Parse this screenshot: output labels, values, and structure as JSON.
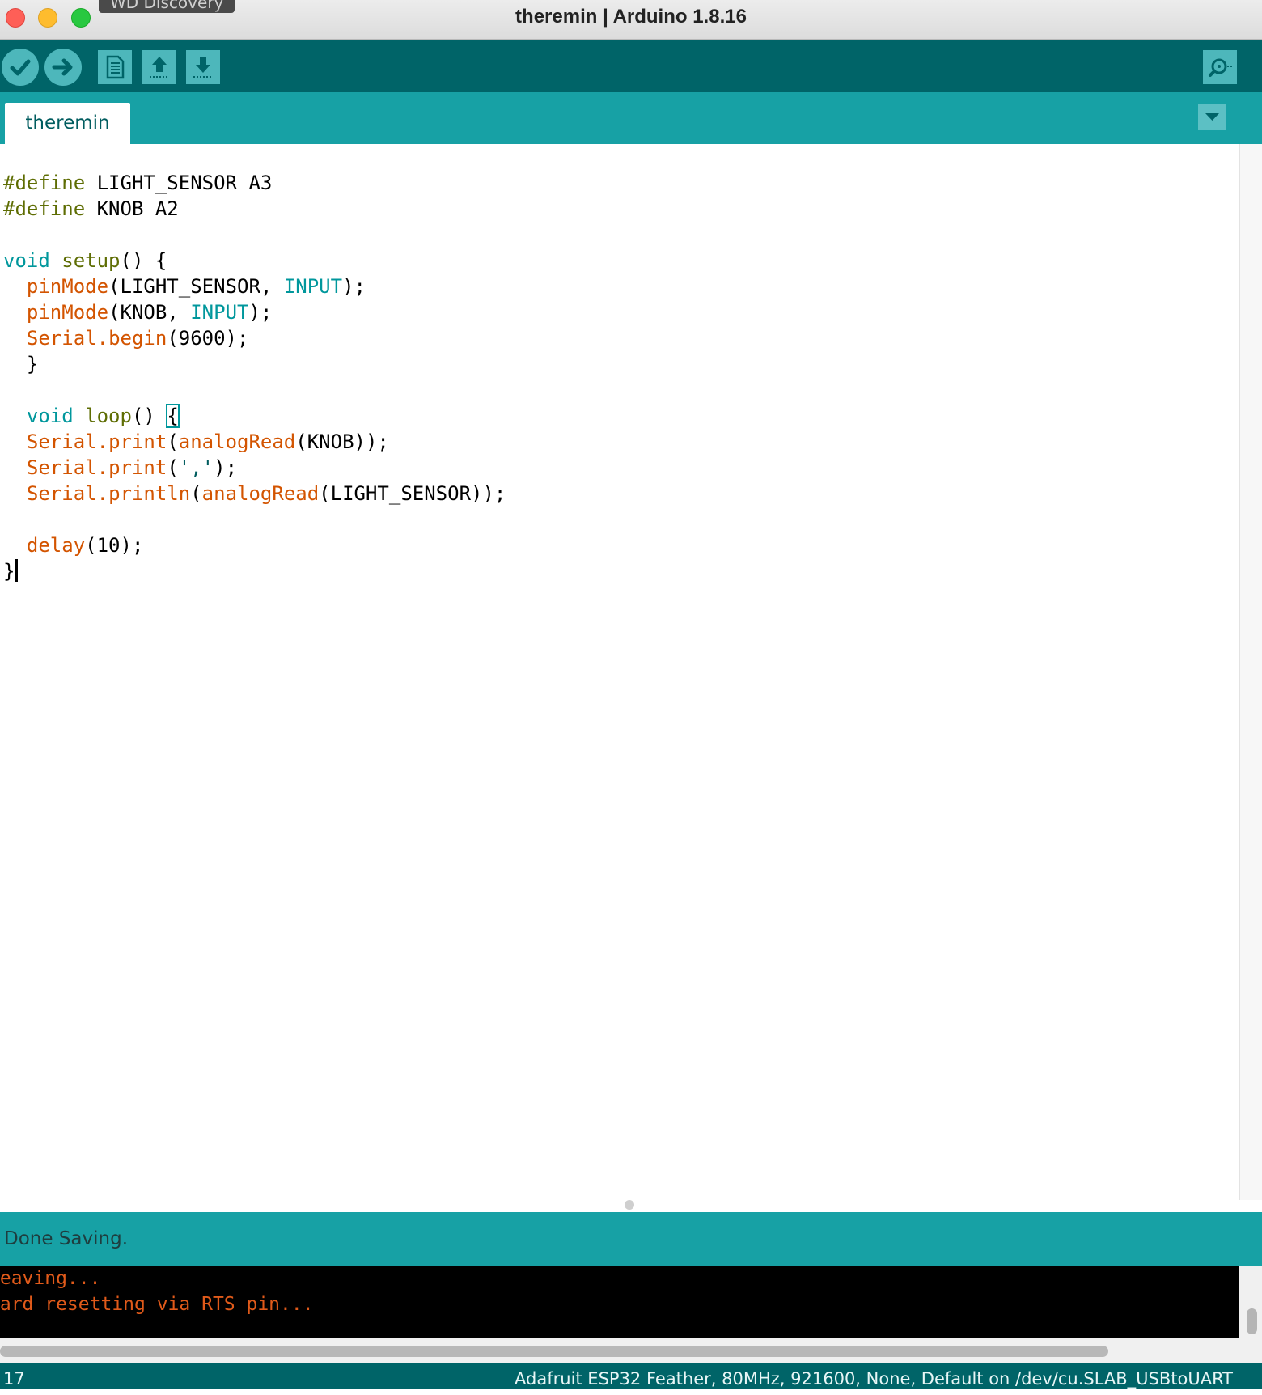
{
  "window": {
    "title": "theremin | Arduino 1.8.16",
    "tooltip": "WD Discovery"
  },
  "toolbar": {
    "verify": "check-icon",
    "upload": "arrow-right-icon",
    "new": "new-file-icon",
    "open": "upload-arrow-icon",
    "save": "download-arrow-icon",
    "serial_monitor": "magnifier-icon"
  },
  "tabs": [
    {
      "label": "theremin",
      "active": true
    }
  ],
  "editor": {
    "lines": [
      [
        {
          "t": "#define",
          "c": "pre"
        },
        {
          "t": " LIGHT_SENSOR A3"
        }
      ],
      [
        {
          "t": "#define",
          "c": "pre"
        },
        {
          "t": " KNOB A2"
        }
      ],
      [],
      [
        {
          "t": "void",
          "c": "type"
        },
        {
          "t": " "
        },
        {
          "t": "setup",
          "c": "pre"
        },
        {
          "t": "() {"
        }
      ],
      [
        {
          "t": "  "
        },
        {
          "t": "pinMode",
          "c": "fn"
        },
        {
          "t": "(LIGHT_SENSOR, "
        },
        {
          "t": "INPUT",
          "c": "const"
        },
        {
          "t": ");"
        }
      ],
      [
        {
          "t": "  "
        },
        {
          "t": "pinMode",
          "c": "fn"
        },
        {
          "t": "(KNOB, "
        },
        {
          "t": "INPUT",
          "c": "const"
        },
        {
          "t": ");"
        }
      ],
      [
        {
          "t": "  "
        },
        {
          "t": "Serial",
          "c": "fn"
        },
        {
          "t": ".",
          "c": "fn"
        },
        {
          "t": "begin",
          "c": "fn"
        },
        {
          "t": "(9600);"
        }
      ],
      [
        {
          "t": "  }"
        }
      ],
      [],
      [
        {
          "t": "  "
        },
        {
          "t": "void",
          "c": "type"
        },
        {
          "t": " "
        },
        {
          "t": "loop",
          "c": "pre"
        },
        {
          "t": "() "
        },
        {
          "t": "{",
          "c": "hl"
        }
      ],
      [
        {
          "t": "  "
        },
        {
          "t": "Serial",
          "c": "fn"
        },
        {
          "t": ".",
          "c": "fn"
        },
        {
          "t": "print",
          "c": "fn"
        },
        {
          "t": "("
        },
        {
          "t": "analogRead",
          "c": "fn"
        },
        {
          "t": "(KNOB));"
        }
      ],
      [
        {
          "t": "  "
        },
        {
          "t": "Serial",
          "c": "fn"
        },
        {
          "t": ".",
          "c": "fn"
        },
        {
          "t": "print",
          "c": "fn"
        },
        {
          "t": "("
        },
        {
          "t": "','",
          "c": "str"
        },
        {
          "t": ");"
        }
      ],
      [
        {
          "t": "  "
        },
        {
          "t": "Serial",
          "c": "fn"
        },
        {
          "t": ".",
          "c": "fn"
        },
        {
          "t": "println",
          "c": "fn"
        },
        {
          "t": "("
        },
        {
          "t": "analogRead",
          "c": "fn"
        },
        {
          "t": "(LIGHT_SENSOR));"
        }
      ],
      [],
      [
        {
          "t": "  "
        },
        {
          "t": "delay",
          "c": "fn"
        },
        {
          "t": "(10);"
        }
      ],
      [
        {
          "t": "}"
        },
        {
          "t": "",
          "c": "caret"
        }
      ]
    ]
  },
  "status": {
    "message": "Done Saving."
  },
  "console": {
    "lines": [
      "Leaving...",
      "Hard resetting via RTS pin..."
    ]
  },
  "footer": {
    "line_number": "17",
    "board": "Adafruit ESP32 Feather, 80MHz, 921600, None, Default on /dev/cu.SLAB_USBtoUART"
  },
  "colors": {
    "toolbar": "#006468",
    "tabstrip": "#17a1a5",
    "button": "#4db7bb",
    "keyword_pre": "#5e6d03",
    "keyword_type": "#00979c",
    "function": "#d35400",
    "console_text": "#e05a1a"
  }
}
